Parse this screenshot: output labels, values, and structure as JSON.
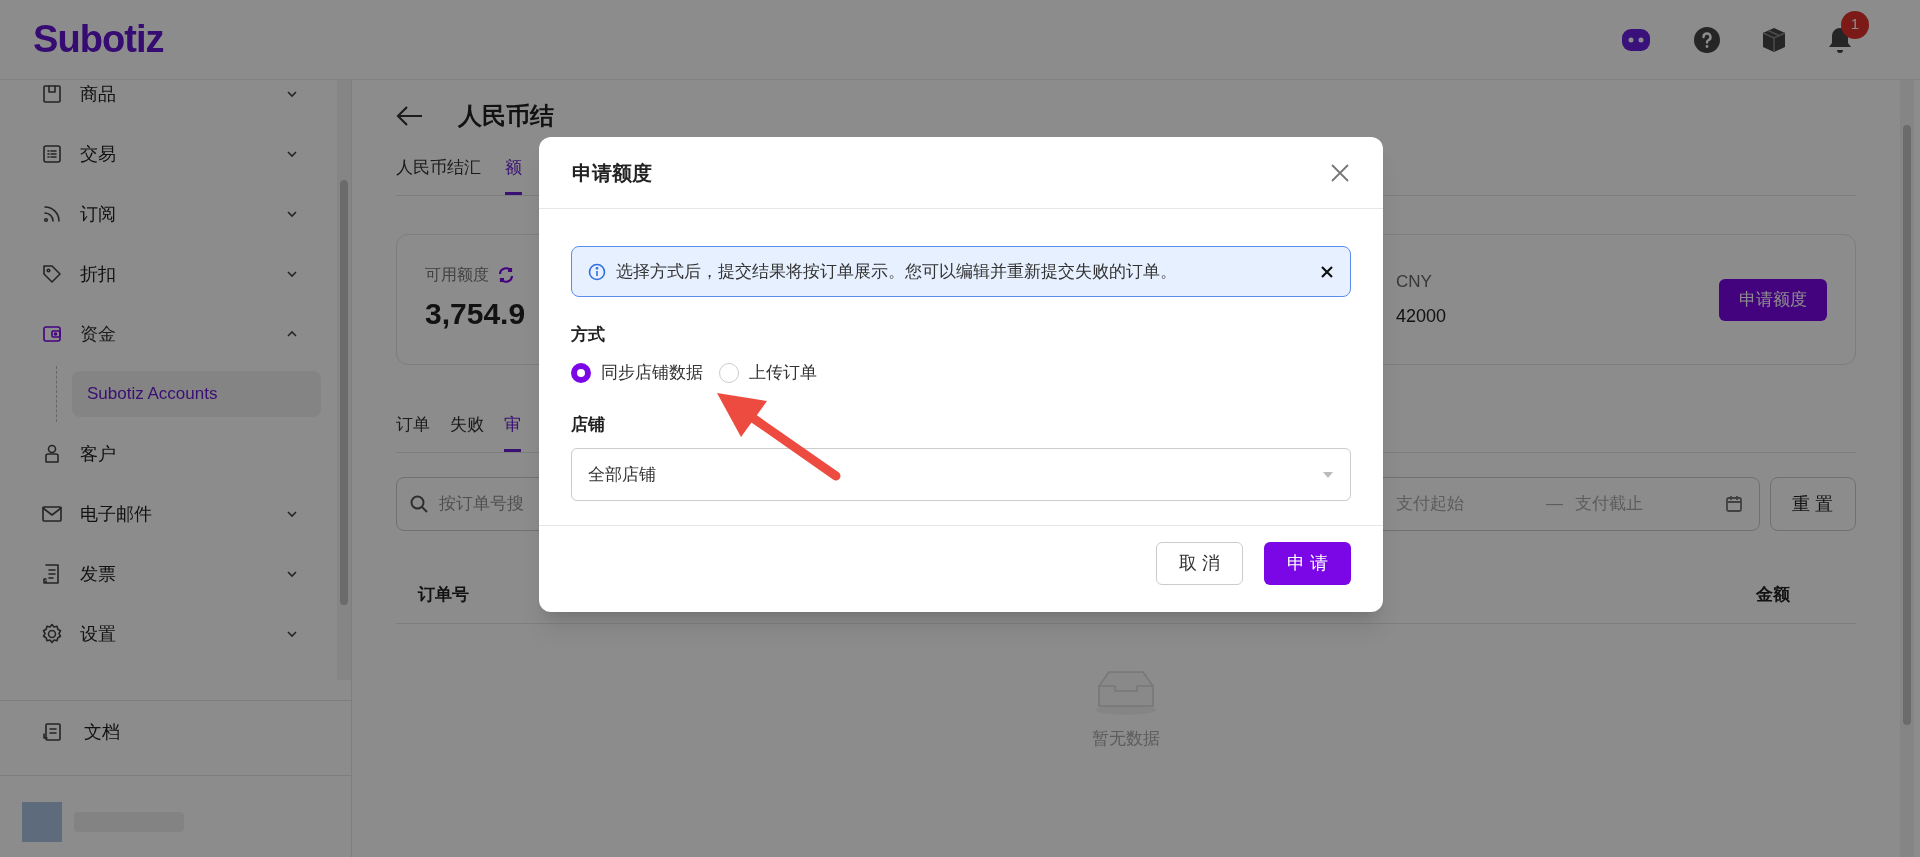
{
  "header": {
    "logo": "Subotiz",
    "notification_count": "1"
  },
  "sidebar": {
    "items": [
      {
        "label": "商品",
        "kind": "group",
        "expanded": false,
        "selected": false
      },
      {
        "label": "交易",
        "kind": "group",
        "expanded": false,
        "selected": false
      },
      {
        "label": "订阅",
        "kind": "group",
        "expanded": false,
        "selected": false
      },
      {
        "label": "折扣",
        "kind": "group",
        "expanded": false,
        "selected": false
      },
      {
        "label": "资金",
        "kind": "group",
        "expanded": true,
        "selected": false,
        "children": [
          {
            "label": "Subotiz Accounts",
            "selected": true
          }
        ]
      },
      {
        "label": "客户",
        "kind": "link",
        "selected": false
      },
      {
        "label": "电子邮件",
        "kind": "group",
        "expanded": false,
        "selected": false
      },
      {
        "label": "发票",
        "kind": "group",
        "expanded": false,
        "selected": false
      },
      {
        "label": "设置",
        "kind": "group",
        "expanded": false,
        "selected": false
      }
    ],
    "footer_item": "文档"
  },
  "page": {
    "title": "人民币结",
    "tabs": [
      {
        "label": "人民币结汇",
        "selected": false
      },
      {
        "label": "额",
        "selected": true
      }
    ],
    "card": {
      "label": "可用额度",
      "amount": "3,754.9",
      "currency": "CNY",
      "limit": "42000",
      "button": "申请额度"
    },
    "subtabs": [
      {
        "label": "订单",
        "selected": false
      },
      {
        "label": "失败",
        "selected": false
      },
      {
        "label": "审",
        "selected": true
      }
    ],
    "search": {
      "placeholder": "按订单号搜"
    },
    "date_range": {
      "start_placeholder": "支付起始",
      "separator": "—",
      "end_placeholder": "支付截止"
    },
    "reset_button": "重 置",
    "table": {
      "columns": [
        "订单号",
        "金额"
      ],
      "empty_text": "暂无数据"
    }
  },
  "modal": {
    "title": "申请额度",
    "alert": "选择方式后，提交结果将按订单展示。您可以编辑并重新提交失败的订单。",
    "method_label": "方式",
    "options": [
      {
        "label": "同步店铺数据",
        "selected": true
      },
      {
        "label": "上传订单",
        "selected": false
      }
    ],
    "store_label": "店铺",
    "store_value": "全部店铺",
    "cancel_button": "取 消",
    "submit_button": "申 请"
  }
}
